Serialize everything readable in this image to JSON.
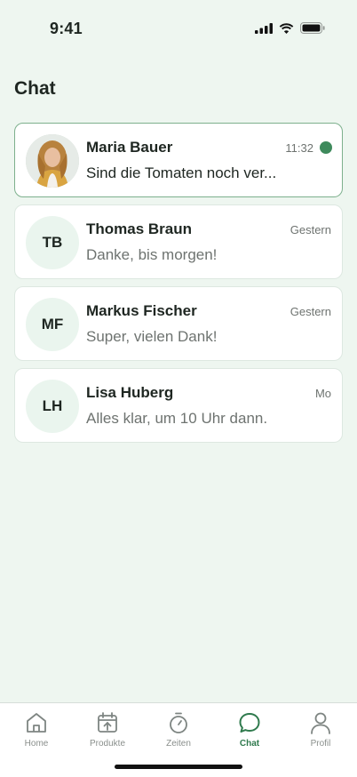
{
  "status": {
    "time": "9:41"
  },
  "page": {
    "title": "Chat"
  },
  "chats": [
    {
      "name": "Maria Bauer",
      "preview": "Sind die Tomaten noch ver...",
      "time": "11:32",
      "initials": "",
      "unread": true
    },
    {
      "name": "Thomas Braun",
      "preview": "Danke, bis morgen!",
      "time": "Gestern",
      "initials": "TB",
      "unread": false
    },
    {
      "name": "Markus Fischer",
      "preview": "Super, vielen Dank!",
      "time": "Gestern",
      "initials": "MF",
      "unread": false
    },
    {
      "name": "Lisa Huberg",
      "preview": "Alles klar, um 10 Uhr dann.",
      "time": "Mo",
      "initials": "LH",
      "unread": false
    }
  ],
  "tabs": [
    {
      "label": "Home",
      "icon": "home-icon"
    },
    {
      "label": "Produkte",
      "icon": "calendar-upload-icon"
    },
    {
      "label": "Zeiten",
      "icon": "stopwatch-icon"
    },
    {
      "label": "Chat",
      "icon": "chat-bubble-icon",
      "active": true
    },
    {
      "label": "Profil",
      "icon": "person-icon"
    }
  ],
  "colors": {
    "accent": "#2F7A4D",
    "unread": "#3E8A5C",
    "background": "#EEF6F0"
  }
}
